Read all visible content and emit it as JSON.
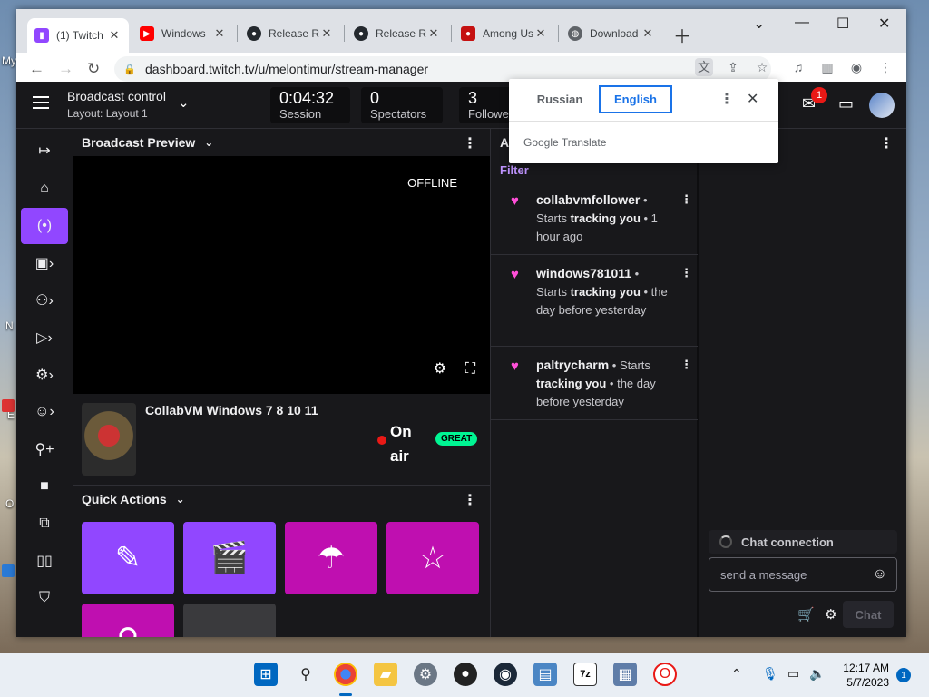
{
  "desktop": {
    "labels": [
      "My",
      "N",
      "E",
      "O"
    ]
  },
  "browser": {
    "tabs": [
      {
        "label": "(1) Twitch",
        "icon": "twitch-icon",
        "color": "#9147ff"
      },
      {
        "label": "Windows",
        "icon": "youtube-icon",
        "color": "#ff0000"
      },
      {
        "label": "Release Re",
        "icon": "github-icon",
        "color": "#24292e"
      },
      {
        "label": "Release Re",
        "icon": "github-icon",
        "color": "#24292e"
      },
      {
        "label": "Among Us",
        "icon": "among-us-icon",
        "color": "#c51111"
      },
      {
        "label": "Download",
        "icon": "globe-icon",
        "color": "#5f6368"
      }
    ],
    "url": "dashboard.twitch.tv/u/melontimur/stream-manager"
  },
  "translate": {
    "source": "Russian",
    "target": "English",
    "brand": "Google Translate"
  },
  "header": {
    "title": "Broadcast control",
    "layout": "Layout: Layout 1",
    "stats": [
      {
        "value": "0:04:32",
        "label": "Session"
      },
      {
        "value": "0",
        "label": "Spectators"
      },
      {
        "value": "3",
        "label": "Followe"
      }
    ],
    "notification_count": "1"
  },
  "preview": {
    "title": "Broadcast Preview",
    "status": "OFFLINE"
  },
  "stream": {
    "title": "CollabVM Windows 7 8 10 11",
    "onair_line1": "On",
    "onair_line2": "air",
    "health": "GREAT",
    "health_color": "#00f593"
  },
  "quick_actions": {
    "title": "Quick Actions",
    "buttons": [
      {
        "icon": "pencil-icon",
        "color": "#9147ff"
      },
      {
        "icon": "clapperboard-icon",
        "color": "#9147ff"
      },
      {
        "icon": "parachute-icon",
        "color": "#bf0fb0"
      },
      {
        "icon": "star-icon",
        "color": "#bf0fb0"
      },
      {
        "icon": "user-icon",
        "color": "#bf0fb0"
      },
      {
        "icon": "more-icon",
        "color": "#3a3a3d"
      }
    ]
  },
  "activity": {
    "title": "A",
    "filter": "Filter",
    "items": [
      {
        "user": "collabvmfollower",
        "pre": "Starts",
        "bold": "tracking you",
        "time": "1 hour ago"
      },
      {
        "user": "windows781011",
        "pre": "Starts",
        "bold": "tracking you",
        "time": "the day before yesterday"
      },
      {
        "user": "paltrycharm",
        "pre": "Starts",
        "bold": "tracking you",
        "time": "the day before yesterday"
      }
    ]
  },
  "chat": {
    "connection": "Chat connection",
    "placeholder": "send a message",
    "send": "Chat"
  },
  "taskbar": {
    "time": "12:17 AM",
    "date": "5/7/2023",
    "notifications": "1"
  }
}
